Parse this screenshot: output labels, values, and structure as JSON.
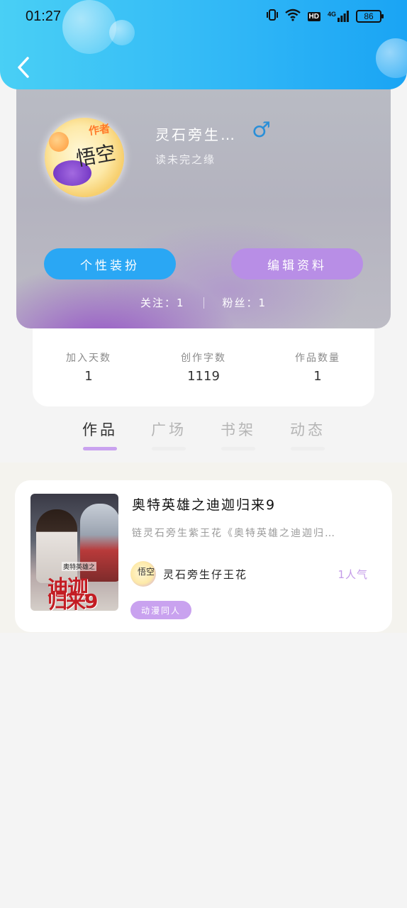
{
  "status_bar": {
    "time": "01:27",
    "hd_label": "HD",
    "network_label": "4G",
    "battery_level": "86"
  },
  "header": {
    "back_icon": "chevron-left-icon",
    "gradient_from": "#49cff5",
    "gradient_to": "#1aa4f4"
  },
  "profile": {
    "avatar_badge": "作者",
    "avatar_text": "悟空",
    "nickname": "灵石旁生…",
    "gender_symbol": "♂",
    "gender_color": "#2a8fd8",
    "signature": "读未完之缘",
    "dress_button": "个性装扮",
    "edit_button": "编辑资料",
    "following": "关注：1",
    "followers": "粉丝：1"
  },
  "stats": [
    {
      "label": "加入天数",
      "value": "1"
    },
    {
      "label": "创作字数",
      "value": "1119"
    },
    {
      "label": "作品数量",
      "value": "1"
    }
  ],
  "tabs": [
    {
      "label": "作品",
      "active": true
    },
    {
      "label": "广场",
      "active": false
    },
    {
      "label": "书架",
      "active": false
    },
    {
      "label": "动态",
      "active": false
    }
  ],
  "accent_color": "#c9a2ef",
  "works": [
    {
      "cover_small_text": "奥特英雄之",
      "cover_line1": "迪迦",
      "cover_line2": "归来9",
      "title": "奥特英雄之迪迦归来9",
      "description": "链灵石旁生紫王花《奥特英雄之迪迦归…",
      "author_avatar_text": "悟空",
      "author": "灵石旁生仔王花",
      "popularity": "1人气",
      "tag": "动漫同人"
    }
  ]
}
